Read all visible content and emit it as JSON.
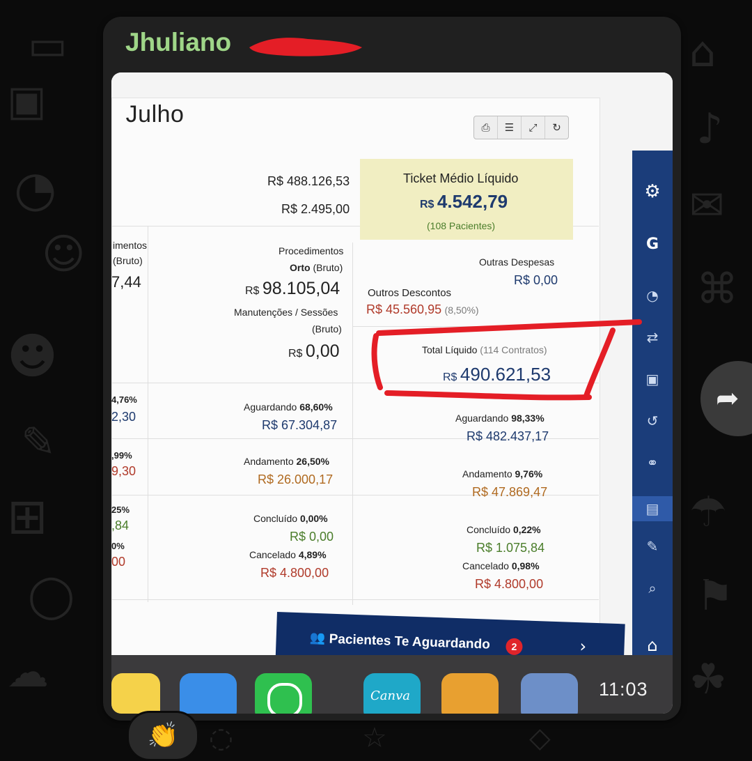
{
  "chat": {
    "sender_name": "Jhuliano",
    "time": "11:03",
    "reaction_emoji": "👏"
  },
  "dashboard": {
    "title_partial": "Julho",
    "left_cutoff": {
      "label_line1": "imentos",
      "label_line2": "(Bruto)",
      "value": "7,44",
      "row1_pct": "4,76%",
      "row1_val": "2,30",
      "row2_pct": ",99%",
      "row2_val": "9,30",
      "row3_pct": "25%",
      "row3_val": ",84",
      "row4_pct": "0%",
      "row4_val": "00"
    },
    "totals": {
      "gross": "R$ 488.126,53",
      "second": "R$ 2.495,00"
    },
    "ticket": {
      "label": "Ticket Médio Líquido",
      "currency": "R$",
      "value": "4.542,79",
      "patients": "(108 Pacientes)"
    },
    "procedimentos": {
      "label_line1": "Procedimentos",
      "label_bold": "Orto",
      "label_suffix": "(Bruto)",
      "currency": "R$",
      "value": "98.105,04"
    },
    "manutencoes": {
      "label_line1": "Manutenções / Sessões",
      "label_line2": "(Bruto)",
      "currency": "R$",
      "value": "0,00"
    },
    "outras_despesas": {
      "label": "Outras Despesas",
      "value": "R$ 0,00"
    },
    "outros_descontos": {
      "label": "Outros Descontos",
      "value": "R$ 45.560,95",
      "pct": "(8,50%)"
    },
    "total_liquido": {
      "label": "Total Líquido",
      "contracts": "(114 Contratos)",
      "currency": "R$",
      "value": "490.621,53"
    },
    "status_mid": [
      {
        "label": "Aguardando",
        "pct": "68,60%",
        "value": "R$ 67.304,87"
      },
      {
        "label": "Andamento",
        "pct": "26,50%",
        "value": "R$ 26.000,17"
      },
      {
        "label": "Concluído",
        "pct": "0,00%",
        "value": "R$ 0,00"
      },
      {
        "label": "Cancelado",
        "pct": "4,89%",
        "value": "R$ 4.800,00"
      }
    ],
    "status_right": [
      {
        "label": "Aguardando",
        "pct": "98,33%",
        "value": "R$ 482.437,17"
      },
      {
        "label": "Andamento",
        "pct": "9,76%",
        "value": "R$ 47.869,47"
      },
      {
        "label": "Concluído",
        "pct": "0,22%",
        "value": "R$ 1.075,84"
      },
      {
        "label": "Cancelado",
        "pct": "0,98%",
        "value": "R$ 4.800,00"
      }
    ],
    "sidebar_partial_label": "G",
    "banner": {
      "label": "Pacientes Te Aguardando",
      "count": "2"
    },
    "dock_canva_label": "Canva"
  },
  "colors": {
    "sender_green": "#9fd688",
    "annotation_red": "#e41e26",
    "nav_blue": "#1b3d7a",
    "ticket_bg": "#f1eec2"
  }
}
